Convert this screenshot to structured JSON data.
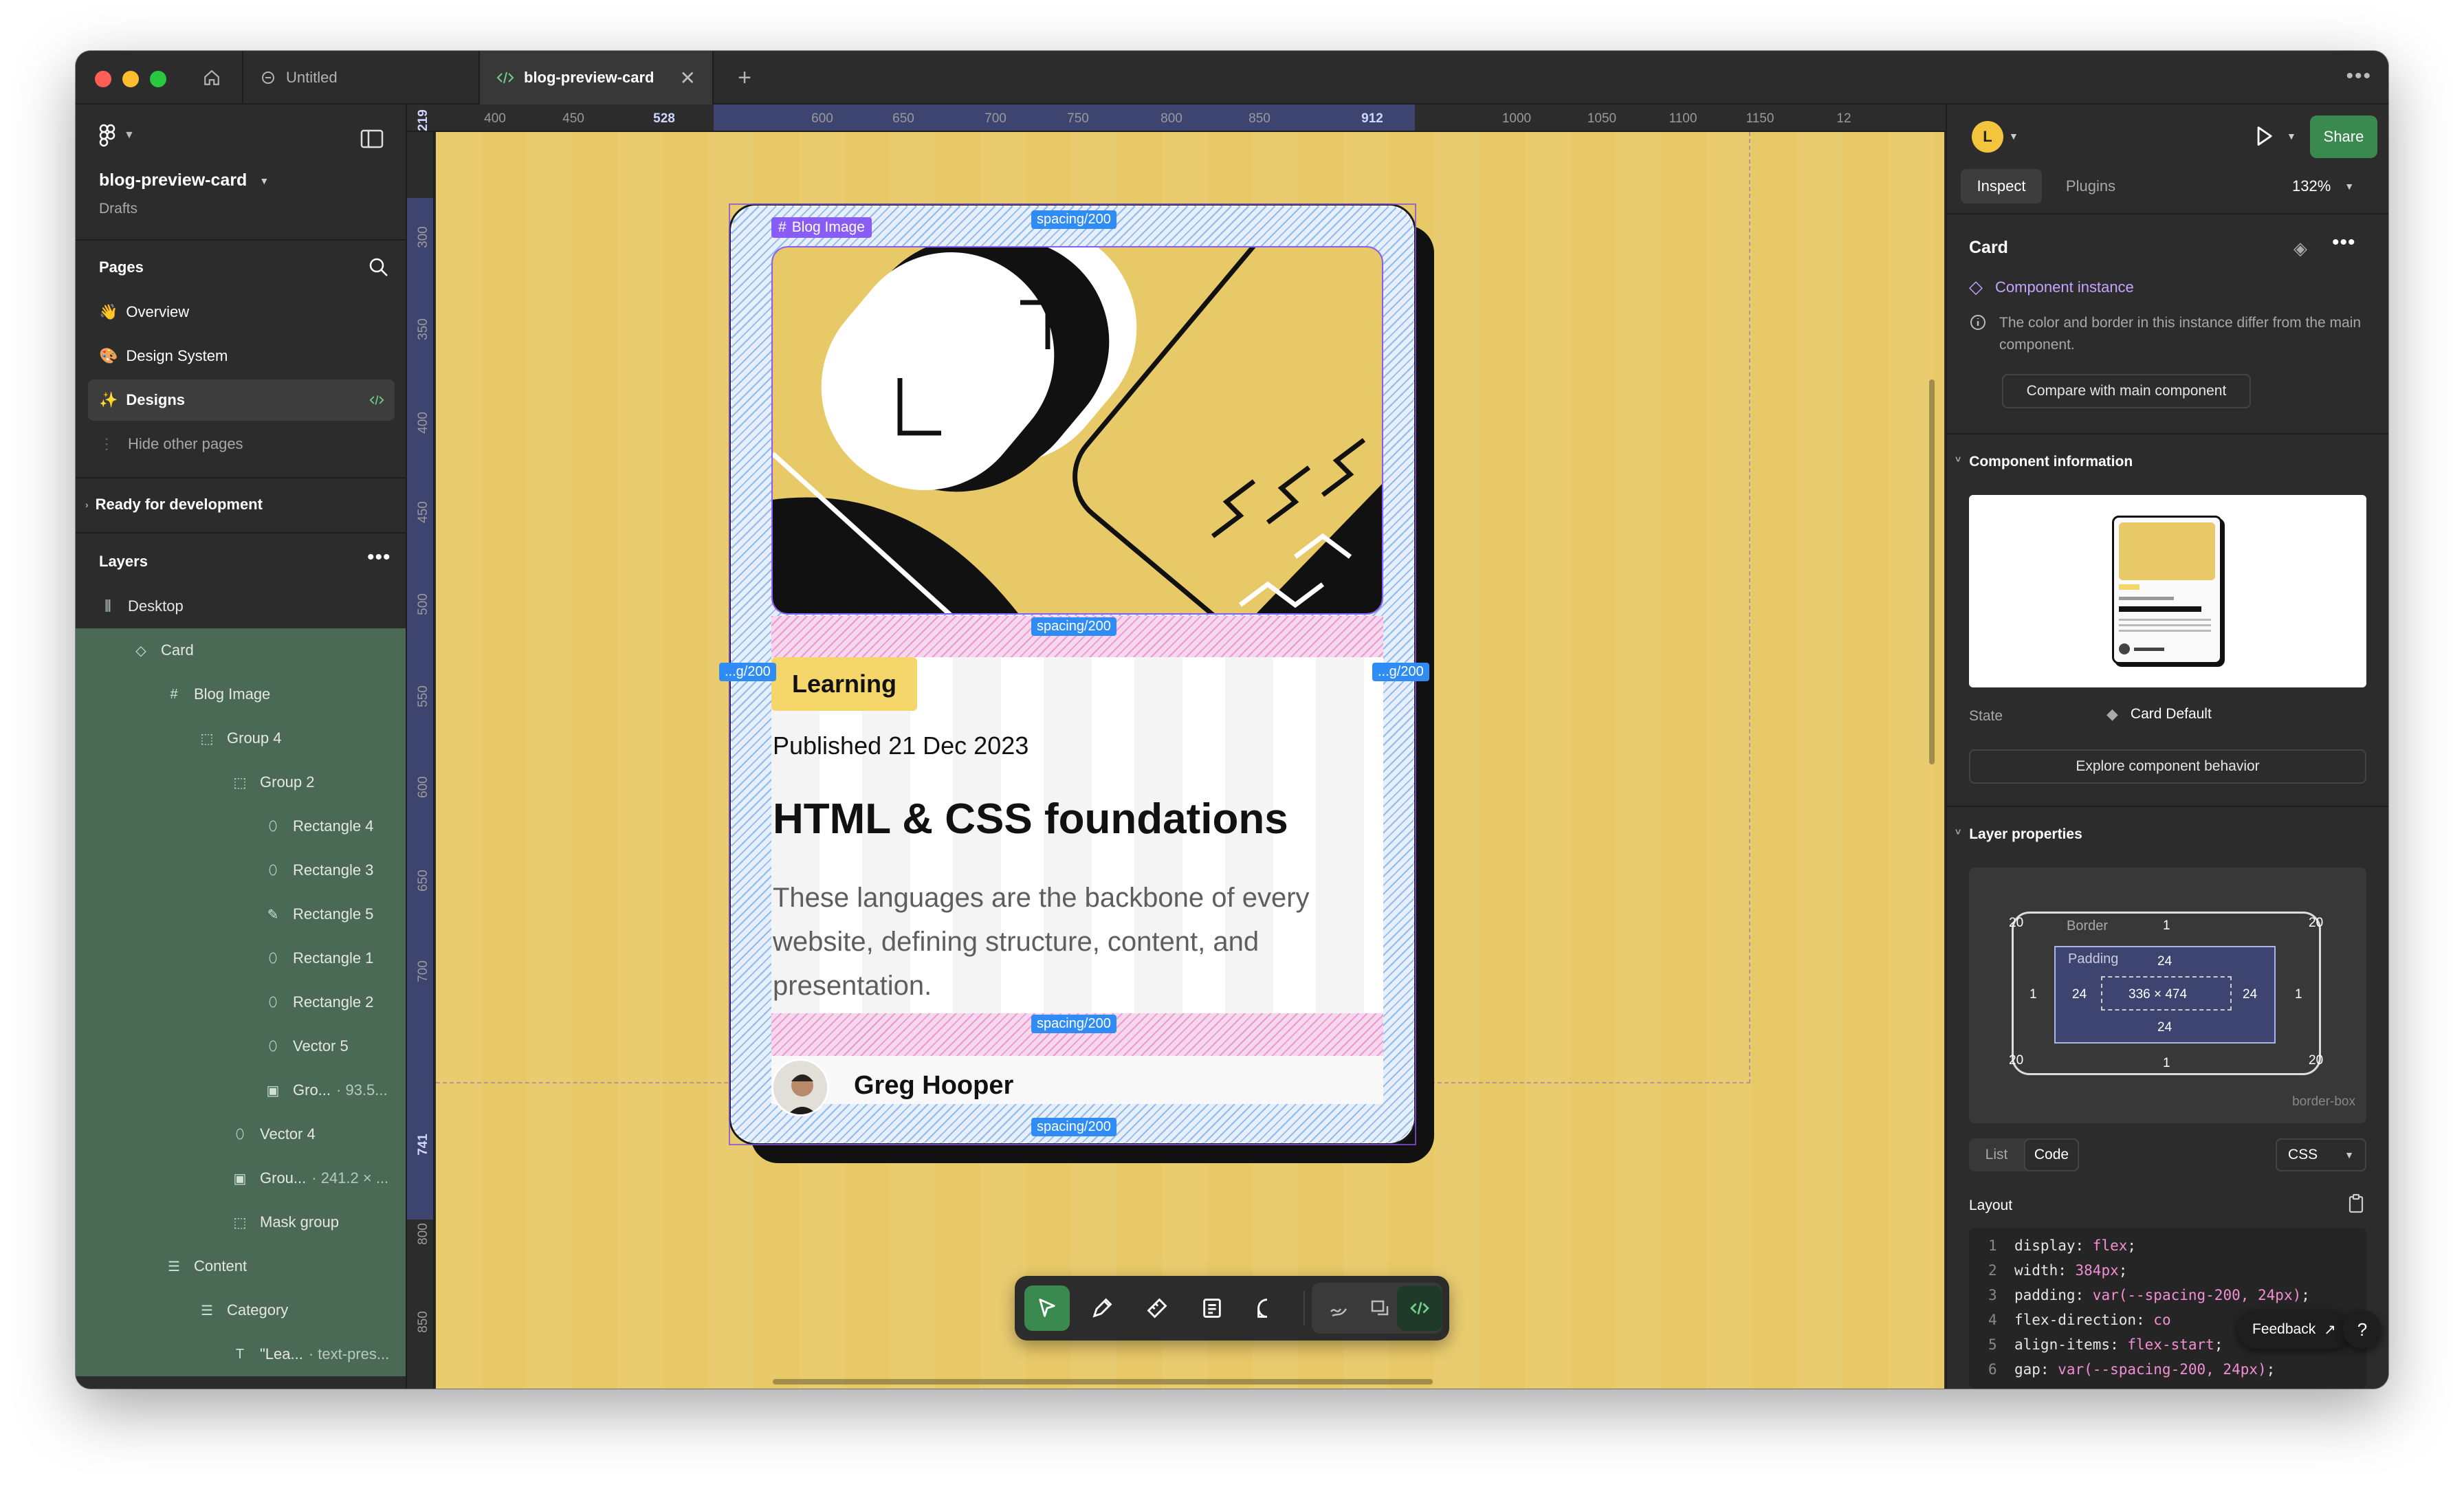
{
  "titlebar": {
    "tabs": [
      {
        "label": "Untitled"
      },
      {
        "label": "blog-preview-card"
      }
    ]
  },
  "left": {
    "file_name": "blog-preview-card",
    "file_location": "Drafts",
    "pages_header": "Pages",
    "pages": [
      {
        "emoji": "👋",
        "label": "Overview"
      },
      {
        "emoji": "🎨",
        "label": "Design System"
      },
      {
        "emoji": "✨",
        "label": "Designs"
      }
    ],
    "hide_other_pages": "Hide other pages",
    "ready_for_dev": "Ready for development",
    "layers_header": "Layers",
    "layers": [
      {
        "label": "Desktop",
        "extra": "",
        "icon": "frame-icon"
      },
      {
        "label": "Card",
        "extra": "",
        "icon": "component-instance-icon"
      },
      {
        "label": "Blog Image",
        "extra": "",
        "icon": "frame-hash-icon"
      },
      {
        "label": "Group 4",
        "extra": "",
        "icon": "group-icon"
      },
      {
        "label": "Group 2",
        "extra": "",
        "icon": "group-icon"
      },
      {
        "label": "Rectangle 4",
        "extra": "",
        "icon": "vector-icon"
      },
      {
        "label": "Rectangle 3",
        "extra": "",
        "icon": "vector-icon"
      },
      {
        "label": "Rectangle 5",
        "extra": "",
        "icon": "pen-icon"
      },
      {
        "label": "Rectangle 1",
        "extra": "",
        "icon": "vector-icon"
      },
      {
        "label": "Rectangle 2",
        "extra": "",
        "icon": "vector-icon"
      },
      {
        "label": "Vector 5",
        "extra": "",
        "icon": "vector-icon"
      },
      {
        "label": "Gro...",
        "extra": "· 93.5...",
        "icon": "image-icon"
      },
      {
        "label": "Vector 4",
        "extra": "",
        "icon": "vector-icon"
      },
      {
        "label": "Grou...",
        "extra": "· 241.2 × ...",
        "icon": "image-icon"
      },
      {
        "label": "Mask group",
        "extra": "",
        "icon": "group-icon"
      },
      {
        "label": "Content",
        "extra": "",
        "icon": "auto-layout-icon"
      },
      {
        "label": "Category",
        "extra": "",
        "icon": "auto-layout-icon"
      },
      {
        "label": "\"Lea...",
        "extra": "· text-pres...",
        "icon": "text-icon"
      }
    ]
  },
  "rulers": {
    "top": [
      "400",
      "450",
      "528",
      "600",
      "650",
      "700",
      "750",
      "800",
      "850",
      "912",
      "1000",
      "1050",
      "1100",
      "1150",
      "12"
    ],
    "left": [
      "219",
      "300",
      "350",
      "400",
      "450",
      "500",
      "550",
      "600",
      "650",
      "700",
      "741",
      "800",
      "850"
    ]
  },
  "card": {
    "image_tag": "Blog Image",
    "spacing_labels": [
      "spacing/200",
      "spacing/200",
      "spacing/200",
      "spacing/200"
    ],
    "side_labels": [
      "...g/200",
      "...g/200"
    ],
    "category": "Learning",
    "published": "Published 21 Dec 2023",
    "title": "HTML & CSS foundations",
    "description": "These languages are the backbone of every website, defining structure, content, and presentation.",
    "author": "Greg Hooper"
  },
  "right": {
    "avatar_letter": "L",
    "share": "Share",
    "tabs": [
      "Inspect",
      "Plugins"
    ],
    "zoom": "132%",
    "selection_title": "Card",
    "component_instance": "Component instance",
    "instance_note": "The color and border in this instance differ from the main component.",
    "compare_button": "Compare with main component",
    "component_info": "Component information",
    "state_label": "State",
    "state_value": "Card Default",
    "explore_button": "Explore component behavior",
    "layer_props": "Layer properties",
    "box": {
      "border_label": "Border",
      "padding_label": "Padding",
      "radius_tl": "20",
      "radius_tr": "20",
      "radius_bl": "20",
      "radius_br": "20",
      "border_top": "1",
      "border_bottom": "1",
      "border_left": "1",
      "border_right": "1",
      "pad_top": "24",
      "pad_bottom": "24",
      "pad_left": "24",
      "pad_right": "24",
      "size": "336 × 474",
      "sizing": "border-box"
    },
    "view_tabs": [
      "List",
      "Code"
    ],
    "lang": "CSS",
    "layout_label": "Layout",
    "code": [
      {
        "n": "1",
        "k": "display: ",
        "v": "flex",
        "t": ";"
      },
      {
        "n": "2",
        "k": "width: ",
        "v": "384px",
        "t": ";"
      },
      {
        "n": "3",
        "k": "padding: ",
        "v": "var(--spacing-200, 24px)",
        "t": ";"
      },
      {
        "n": "4",
        "k": "flex-direction: ",
        "v": "co",
        "t": ""
      },
      {
        "n": "5",
        "k": "align-items: ",
        "v": "flex-start",
        "t": ";"
      },
      {
        "n": "6",
        "k": "gap: ",
        "v": "var(--spacing-200, 24px)",
        "t": ";"
      }
    ],
    "feedback": "Feedback",
    "help": "?"
  },
  "colors": {
    "canvas": "#e8c968",
    "accent_green": "#3a8a4f",
    "selection_blue": "#2f8cf5",
    "component_purple": "#c6a4ff"
  }
}
